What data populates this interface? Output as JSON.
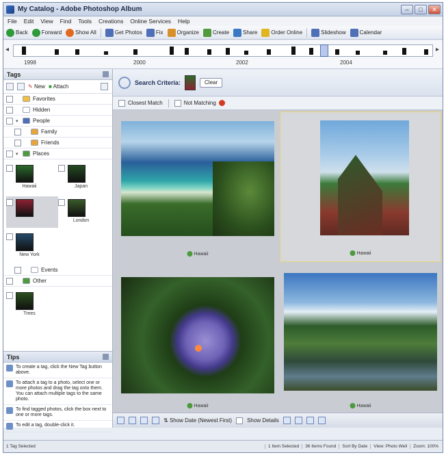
{
  "window": {
    "title": "My Catalog - Adobe Photoshop Album"
  },
  "menu": [
    "File",
    "Edit",
    "View",
    "Find",
    "Tools",
    "Creations",
    "Online Services",
    "Help"
  ],
  "toolbar": [
    {
      "label": "Back",
      "icon": "back-arrow-icon",
      "color": "#2f9a3a"
    },
    {
      "label": "Forward",
      "icon": "forward-arrow-icon",
      "color": "#2f9a3a"
    },
    {
      "label": "Show All",
      "icon": "stop-icon",
      "color": "#e06a1f"
    },
    {
      "label": "Get Photos",
      "icon": "camera-icon",
      "color": "#4f6fb6"
    },
    {
      "label": "Fix",
      "icon": "wand-icon",
      "color": "#4f6fb6"
    },
    {
      "label": "Organize",
      "icon": "organize-icon",
      "color": "#d8902a"
    },
    {
      "label": "Create",
      "icon": "create-icon",
      "color": "#4f9a3a"
    },
    {
      "label": "Share",
      "icon": "share-icon",
      "color": "#3a78c4"
    },
    {
      "label": "Order Online",
      "icon": "order-icon",
      "color": "#e0b520"
    },
    {
      "label": "Slideshow",
      "icon": "slideshow-icon",
      "color": "#4f6fb6"
    },
    {
      "label": "Calendar",
      "icon": "calendar-icon",
      "color": "#4f6fb6"
    }
  ],
  "timeline": {
    "years": [
      "1998",
      "2000",
      "2002",
      "2004"
    ]
  },
  "tags_panel": {
    "title": "Tags",
    "tools": {
      "new": "New",
      "attach": "Attach"
    },
    "rows": [
      {
        "label": "Favorites",
        "indent": 0,
        "color": "#f0c040"
      },
      {
        "label": "Hidden",
        "indent": 0,
        "color": "#ffffff"
      },
      {
        "label": "People",
        "indent": 0,
        "color": "#4f6fb6"
      },
      {
        "label": "Family",
        "indent": 1,
        "color": "#e9a53a"
      },
      {
        "label": "Friends",
        "indent": 1,
        "color": "#e9a53a"
      },
      {
        "label": "Places",
        "indent": 0,
        "color": "#4f9a3a"
      }
    ],
    "place_thumbs": [
      {
        "label": "Hawaii",
        "color": "#2c6a2c"
      },
      {
        "label": "Japan",
        "color": "#234a23"
      },
      {
        "label": "",
        "color": "#8b2233"
      },
      {
        "label": "London",
        "color": "#3a5a2a"
      },
      {
        "label": "New York",
        "color": "#244a6a"
      }
    ],
    "rows2": [
      {
        "label": "Events",
        "indent": 1,
        "color": "#ffffff"
      },
      {
        "label": "Other",
        "indent": 0,
        "color": "#4f9a3a"
      }
    ],
    "other_thumb": {
      "label": "Trees",
      "color": "#2a4f1d"
    }
  },
  "tips_panel": {
    "title": "Tips",
    "tips": [
      "To create a tag, click the New Tag button above.",
      "To attach a tag to a photo, select one or more photos and drag the tag onto them. You can attach multiple tags to the same photo.",
      "To find tagged photos, click the box next to one or more tags.",
      "To edit a tag, double-click it."
    ]
  },
  "search": {
    "label": "Search Criteria:",
    "clear_label": "Clear"
  },
  "filters": {
    "closest_match": "Closest Match",
    "not_matching": "Not Matching"
  },
  "photos": [
    {
      "tag": "Hawaii",
      "style": "beach"
    },
    {
      "tag": "Hawaii",
      "style": "cliff"
    },
    {
      "tag": "Hawaii",
      "style": "orchid"
    },
    {
      "tag": "Hawaii",
      "style": "stream"
    }
  ],
  "bottom_bar": {
    "date_view": "Show Date (Newest First)",
    "show_details": "Show Details"
  },
  "status": {
    "left": "1 Tag Selected",
    "segments": [
      "1 Item Selected",
      "36 Items Found",
      "Sort By Date",
      "View: Photo Well",
      "Zoom: 100%"
    ]
  }
}
